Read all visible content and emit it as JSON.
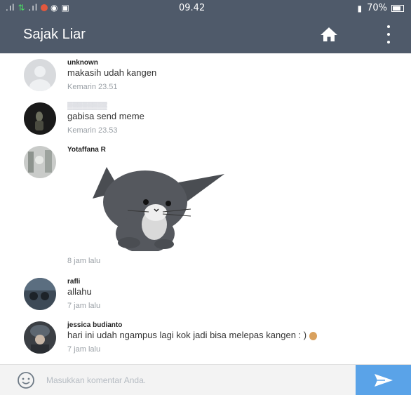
{
  "statusbar": {
    "time": "09.42",
    "battery": "70%"
  },
  "appbar": {
    "title": "Sajak Liar",
    "icons": [
      "home-icon",
      "more-vert-icon"
    ]
  },
  "comments": [
    {
      "name": "unknown",
      "text": "makasih udah kangen",
      "time": "Kemarin 23.51"
    },
    {
      "name": "▒▒▒▒▒▒▒▒",
      "text": "gabisa send meme",
      "time": "Kemarin 23.53"
    },
    {
      "name": "Yotaffana R",
      "text": "",
      "sticker": "cat-sticker",
      "time": "8 jam lalu"
    },
    {
      "name": "rafli",
      "text": "allahu",
      "time": "7 jam lalu"
    },
    {
      "name": "jessica budianto",
      "text": "hari ini udah ngampus lagi kok jadi bisa melepas kangen : )",
      "time": "7 jam lalu"
    }
  ],
  "composer": {
    "placeholder": "Masukkan komentar Anda."
  },
  "colors": {
    "bar": "#4f5a6a",
    "send": "#5aa3e8"
  }
}
